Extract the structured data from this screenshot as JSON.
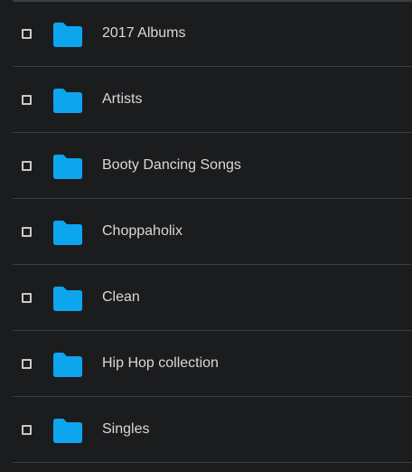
{
  "folders": [
    {
      "name": "2017 Albums",
      "icon": "folder-icon"
    },
    {
      "name": "Artists",
      "icon": "folder-icon"
    },
    {
      "name": "Booty Dancing Songs",
      "icon": "folder-icon"
    },
    {
      "name": "Choppaholix",
      "icon": "folder-icon"
    },
    {
      "name": "Clean",
      "icon": "folder-icon"
    },
    {
      "name": "Hip Hop collection",
      "icon": "folder-icon"
    },
    {
      "name": "Singles",
      "icon": "folder-icon"
    }
  ],
  "colors": {
    "background": "#1b1c1e",
    "folder": "#0ea5ef",
    "text": "#d8d8d8",
    "divider": "#3a3c3f"
  }
}
